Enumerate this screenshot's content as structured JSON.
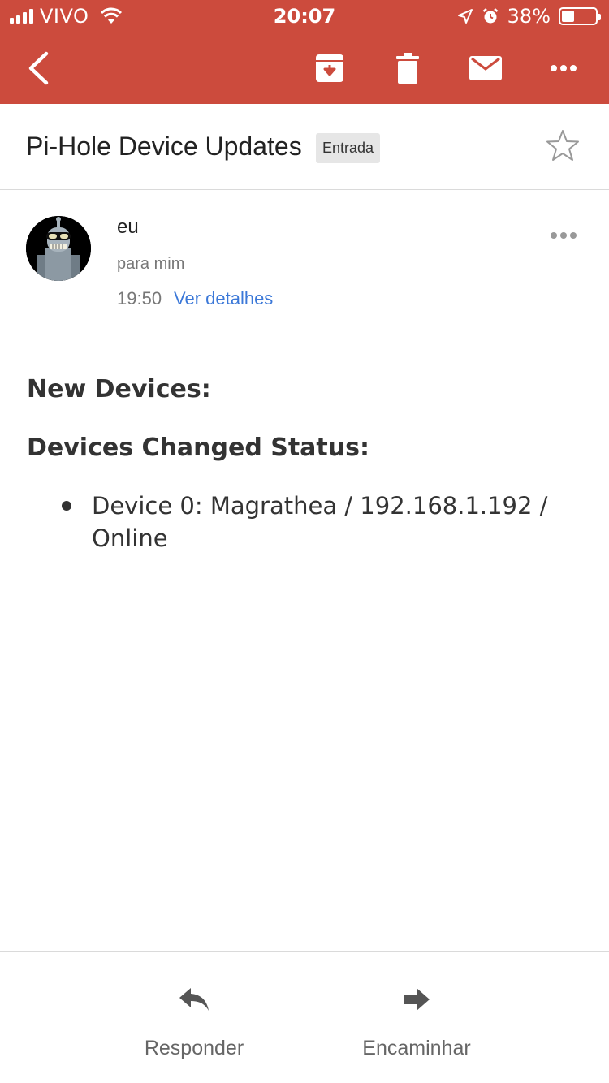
{
  "status_bar": {
    "carrier": "VIVO",
    "time": "20:07",
    "battery_percent_text": "38%",
    "battery_level": 0.38
  },
  "toolbar": {
    "back_icon": "chevron-left-icon",
    "archive_icon": "archive-icon",
    "delete_icon": "trash-icon",
    "mark_unread_icon": "mail-icon",
    "more_icon": "more-horizontal-icon"
  },
  "email": {
    "subject": "Pi-Hole Device Updates",
    "label": "Entrada",
    "sender": "eu",
    "recipient": "para mim",
    "time": "19:50",
    "details_link": "Ver detalhes"
  },
  "body": {
    "heading_new": "New Devices:",
    "heading_changed": "Devices Changed Status:",
    "items": [
      "Device 0: Magrathea / 192.168.1.192 / Online"
    ]
  },
  "actions": {
    "reply": "Responder",
    "forward": "Encaminhar"
  },
  "colors": {
    "header": "#cc4b3d",
    "link": "#3b78d8"
  }
}
